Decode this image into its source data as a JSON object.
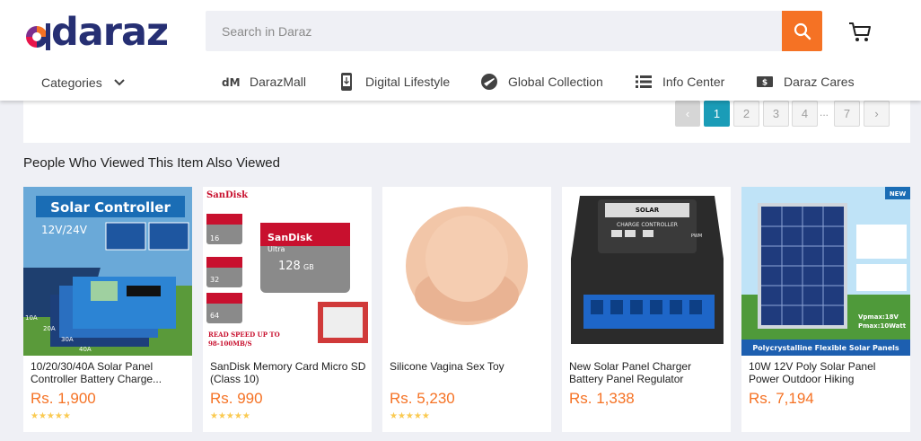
{
  "brand": {
    "name": "daraz"
  },
  "search": {
    "placeholder": "Search in Daraz"
  },
  "colors": {
    "accent": "#f57224",
    "brand_navy": "#262f73",
    "active_page": "#1a9cb7",
    "star": "#faca51"
  },
  "nav": {
    "categories_label": "Categories",
    "items": [
      {
        "label": "DarazMall",
        "icon": "darazmall-icon"
      },
      {
        "label": "Digital Lifestyle",
        "icon": "phone-icon"
      },
      {
        "label": "Global Collection",
        "icon": "plane-icon"
      },
      {
        "label": "Info Center",
        "icon": "list-icon"
      },
      {
        "label": "Daraz Cares",
        "icon": "cash-icon"
      }
    ]
  },
  "pagination": {
    "prev": "‹",
    "pages": [
      "1",
      "2",
      "3",
      "4"
    ],
    "dots": "...",
    "last": "7",
    "next": "›",
    "current": "1"
  },
  "section": {
    "title": "People Who Viewed This Item Also Viewed"
  },
  "products": [
    {
      "name": "10/20/30/40A Solar Panel Controller Battery Charge...",
      "price": "Rs. 1,900",
      "stars": "★★★★★",
      "rating": 4.5,
      "img_text": [
        "Solar Controller",
        "12V/24V",
        "10A",
        "20A",
        "30A",
        "40A"
      ]
    },
    {
      "name": "SanDisk Memory Card Micro SD (Class 10)",
      "price": "Rs. 990",
      "stars": "★★★★★",
      "rating": 4.5,
      "img_text": [
        "SanDisk",
        "128",
        "GB",
        "Ultra",
        "16",
        "32",
        "64",
        "READ SPEED UP TO",
        "98-100MB/S"
      ]
    },
    {
      "name": "Silicone Vagina Sex Toy",
      "price": "Rs. 5,230",
      "stars": "★★★★★",
      "rating": 5
    },
    {
      "name": "New Solar Panel Charger Battery Panel Regulator Controller PW...",
      "price": "Rs. 1,338",
      "stars": "",
      "img_text": [
        "SOLAR",
        "CHARGE CONTROLLER",
        "PWM"
      ]
    },
    {
      "name": "10W 12V Poly Solar Panel Power Outdoor Hiking Camping...",
      "price": "Rs. 7,194",
      "stars": "",
      "img_text": [
        "NEW",
        "Vpmax:18V",
        "Pmax:10Watt",
        "Polycrystalline Flexible Solar Panels"
      ]
    }
  ]
}
